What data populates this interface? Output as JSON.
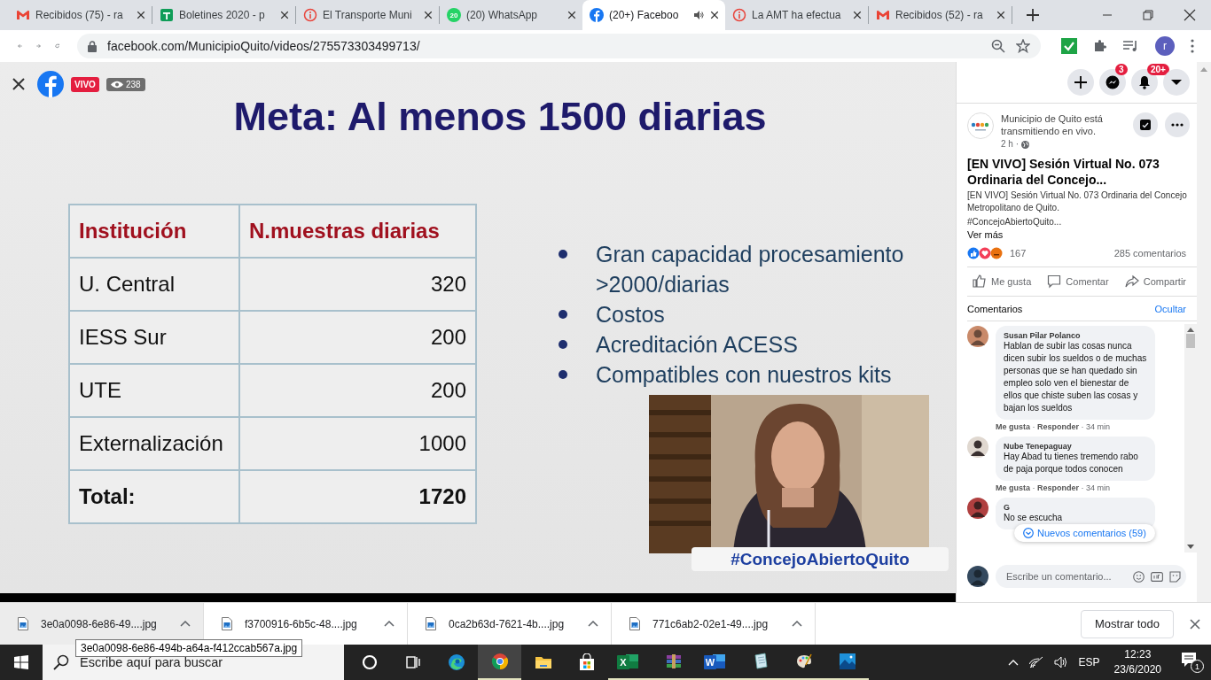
{
  "browser": {
    "tabs": [
      {
        "title": "Recibidos (75) - ra",
        "kind": "gmail",
        "selected": false,
        "audio": false
      },
      {
        "title": "Boletines 2020 - p",
        "kind": "sheets",
        "selected": false,
        "audio": false
      },
      {
        "title": "El Transporte Muni",
        "kind": "alert",
        "selected": false,
        "audio": false
      },
      {
        "title": "(20) WhatsApp",
        "kind": "whatsapp",
        "icon_text": "20",
        "selected": false,
        "audio": false
      },
      {
        "title": "(20+) Faceboo",
        "kind": "facebook",
        "selected": true,
        "audio": true
      },
      {
        "title": "La AMT ha efectua",
        "kind": "alert",
        "selected": false,
        "audio": false
      },
      {
        "title": "Recibidos (52) - ra",
        "kind": "gmail",
        "selected": false,
        "audio": false
      }
    ],
    "url": "facebook.com/MunicipioQuito/videos/275573303499713/",
    "profile_initial": "r"
  },
  "video": {
    "live_label": "VIVO",
    "viewers": "238",
    "slide": {
      "title": "Meta: Al menos 1500 diarias",
      "table": {
        "columns": [
          "Institución",
          "N.muestras diarias"
        ],
        "rows": [
          {
            "cells": [
              "U. Central",
              "320"
            ],
            "total": false
          },
          {
            "cells": [
              "IESS Sur",
              "200"
            ],
            "total": false
          },
          {
            "cells": [
              "UTE",
              "200"
            ],
            "total": false
          },
          {
            "cells": [
              "Externalización",
              "1000"
            ],
            "total": false
          },
          {
            "cells": [
              "Total:",
              "1720"
            ],
            "total": true
          }
        ]
      },
      "bullets": [
        "Gran capacidad procesamiento >2000/diarias",
        "Costos",
        "Acreditación ACESS",
        "Compatibles con nuestros kits"
      ]
    },
    "hashtag": "#ConcejoAbiertoQuito"
  },
  "facebook": {
    "header_buttons": [
      {
        "kind": "plus"
      },
      {
        "kind": "messenger",
        "badge": "3"
      },
      {
        "kind": "bell",
        "badge": "20+"
      },
      {
        "kind": "caret"
      }
    ],
    "post": {
      "author_line": "Municipio de Quito está transmitiendo en vivo.",
      "time": "2 h ·",
      "title": "[EN VIVO] Sesión Virtual No. 073 Ordinaria del Concejo...",
      "description": [
        "[EN VIVO] Sesión Virtual No. 073 Ordinaria del Concejo Metropolitano de Quito.",
        "#ConcejoAbiertoQuito..."
      ],
      "see_more": "Ver más",
      "reactions": "167",
      "comments_count": "285 comentarios",
      "actions": [
        {
          "kind": "like",
          "label": "Me gusta"
        },
        {
          "kind": "comment",
          "label": "Comentar"
        },
        {
          "kind": "share",
          "label": "Compartir"
        }
      ]
    },
    "comments": {
      "title": "Comentarios",
      "hide": "Ocultar",
      "items": [
        {
          "author": "Susan Pilar Polanco",
          "text": "Hablan de subir las cosas nunca dicen subir los sueldos o de muchas personas que se han quedado sin empleo solo ven el bienestar de ellos que chiste suben las cosas y bajan los sueldos",
          "meta": "**Me gusta** · **Responder** · 34 min"
        },
        {
          "author": "Nube Tenepaguay",
          "text": "Hay Abad tu tienes tremendo rabo de paja porque todos conocen",
          "meta": "**Me gusta** · **Responder** · 34 min"
        },
        {
          "author": "G",
          "text": "No se escucha"
        }
      ],
      "new_comments": "Nuevos comentarios (59)",
      "input_placeholder": "Escribe un comentario..."
    }
  },
  "downloads": {
    "items": [
      {
        "name": "3e0a0098-6e86-49....jpg",
        "hovered": true
      },
      {
        "name": "f3700916-6b5c-48....jpg",
        "hovered": false
      },
      {
        "name": "0ca2b63d-7621-4b....jpg",
        "hovered": false
      },
      {
        "name": "771c6ab2-02e1-49....jpg",
        "hovered": false
      }
    ],
    "tooltip": "3e0a0098-6e86-494b-a64a-f412ccab567a.jpg",
    "show_all": "Mostrar todo"
  },
  "taskbar": {
    "search_placeholder": "Escribe aquí para buscar",
    "apps": [
      {
        "kind": "cortana",
        "selected": false,
        "running": false
      },
      {
        "kind": "taskview",
        "selected": false,
        "running": false
      },
      {
        "kind": "edge",
        "selected": false,
        "running": false
      },
      {
        "kind": "chrome",
        "selected": true,
        "running": true
      },
      {
        "kind": "folder",
        "selected": false,
        "running": false
      },
      {
        "kind": "store",
        "selected": false,
        "running": false
      },
      {
        "kind": "excel",
        "label": "X",
        "selected": false,
        "running": true
      },
      {
        "kind": "winrar",
        "selected": false,
        "running": true
      },
      {
        "kind": "word",
        "label": "W",
        "selected": false,
        "running": true
      },
      {
        "kind": "notepad",
        "selected": false,
        "running": true
      },
      {
        "kind": "paint",
        "selected": false,
        "running": true
      },
      {
        "kind": "photos",
        "selected": false,
        "running": true
      }
    ],
    "language": "ESP",
    "time": "12:23",
    "date": "23/6/2020",
    "notifications": "1"
  }
}
